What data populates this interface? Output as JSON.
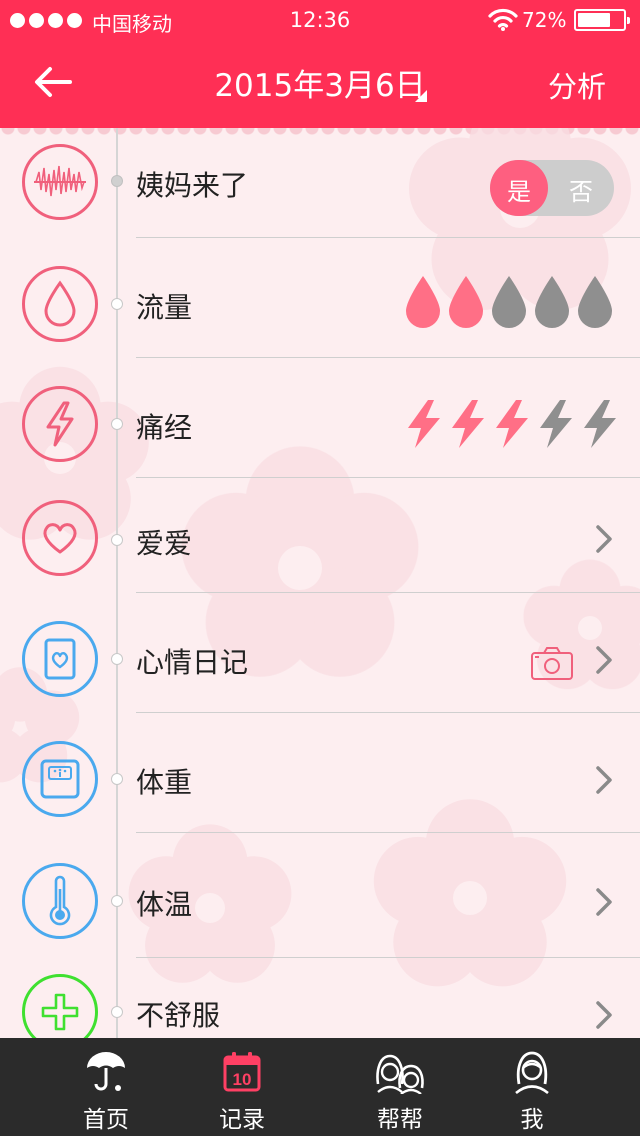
{
  "status_bar": {
    "carrier": "中国移动",
    "time": "12:36",
    "battery": "72%",
    "battery_level": 0.72
  },
  "nav": {
    "title": "2015年3月6日",
    "right_action": "分析",
    "back_icon": "arrow-left-icon"
  },
  "rows": [
    {
      "label": "姨妈来了",
      "icon": "period-wave-icon",
      "control": "toggle",
      "toggle": {
        "yes": "是",
        "no": "否",
        "selected": "是"
      }
    },
    {
      "label": "流量",
      "icon": "drop-icon",
      "control": "rating",
      "rating": {
        "value": 2,
        "max": 5,
        "active_color": "#ff6f86",
        "inactive_color": "#8f8f8f"
      }
    },
    {
      "label": "痛经",
      "icon": "lightning-icon",
      "control": "rating",
      "rating": {
        "value": 3,
        "max": 5,
        "active_color": "#ff6f86",
        "inactive_color": "#8f8f8f"
      }
    },
    {
      "label": "爱爱",
      "icon": "heart-icon",
      "control": "chevron"
    },
    {
      "label": "心情日记",
      "icon": "mood-card-icon",
      "control": "camera-chevron"
    },
    {
      "label": "体重",
      "icon": "scale-icon",
      "control": "chevron"
    },
    {
      "label": "体温",
      "icon": "thermometer-icon",
      "control": "chevron"
    },
    {
      "label": "不舒服",
      "icon": "plus-icon",
      "control": "chevron"
    }
  ],
  "tabs": [
    {
      "label": "首页",
      "icon": "umbrella-icon",
      "active": false
    },
    {
      "label": "记录",
      "icon": "calendar-icon",
      "active": true,
      "badge": "10"
    },
    {
      "label": "帮帮",
      "icon": "friends-icon",
      "active": false
    },
    {
      "label": "我",
      "icon": "profile-icon",
      "active": false
    }
  ],
  "colors": {
    "brand": "#ff2f55",
    "pink": "#f0607c",
    "blue": "#4aa9ee",
    "green": "#3fe030",
    "tab_bg": "#2b2b2b"
  }
}
